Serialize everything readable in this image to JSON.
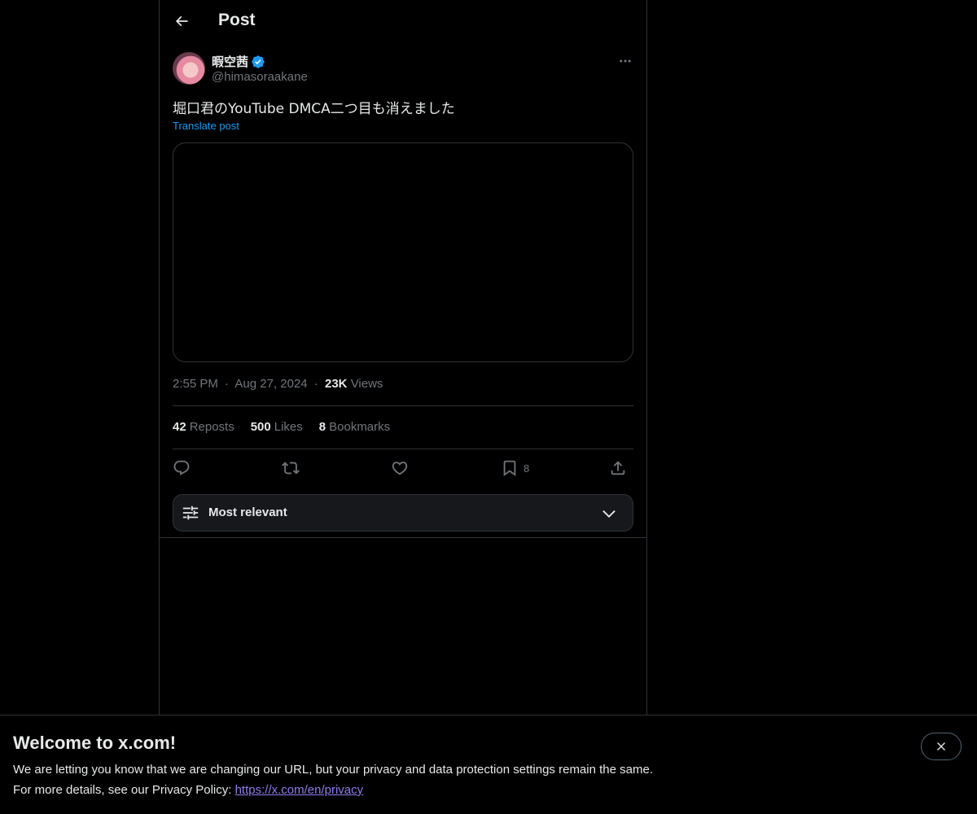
{
  "header": {
    "title": "Post",
    "back_icon": "arrow-left-icon"
  },
  "post": {
    "author_name": "暇空茜",
    "author_handle": "@himasoraakane",
    "verified": true,
    "text": "堀口君のYouTube DMCA二つ目も消えました",
    "translate_label": "Translate post",
    "time": "2:55 PM",
    "date": "Aug 27, 2024",
    "views_count": "23K",
    "views_label": "Views",
    "separator": "·"
  },
  "stats": {
    "reposts_count": "42",
    "reposts_label": "Reposts",
    "likes_count": "500",
    "likes_label": "Likes",
    "bookmarks_count": "8",
    "bookmarks_label": "Bookmarks"
  },
  "actions": {
    "reply_icon": "reply-icon",
    "repost_icon": "repost-icon",
    "like_icon": "heart-icon",
    "bookmark_icon": "bookmark-icon",
    "bookmark_count": "8",
    "share_icon": "share-icon"
  },
  "sort": {
    "label": "Most relevant",
    "icon": "sliders-icon",
    "chevron": "chevron-down-icon"
  },
  "banner": {
    "title": "Welcome to x.com!",
    "line1": "We are letting you know that we are changing our URL, but your privacy and data protection settings remain the same.",
    "line2_prefix": "For more details, see our Privacy Policy: ",
    "link": "https://x.com/en/privacy",
    "close_icon": "close-icon"
  },
  "colors": {
    "background": "#000000",
    "text_primary": "#e7e9ea",
    "text_secondary": "#71767b",
    "accent": "#1d9bf0",
    "border": "#2f3336",
    "link_visited": "#8e7ee8"
  }
}
